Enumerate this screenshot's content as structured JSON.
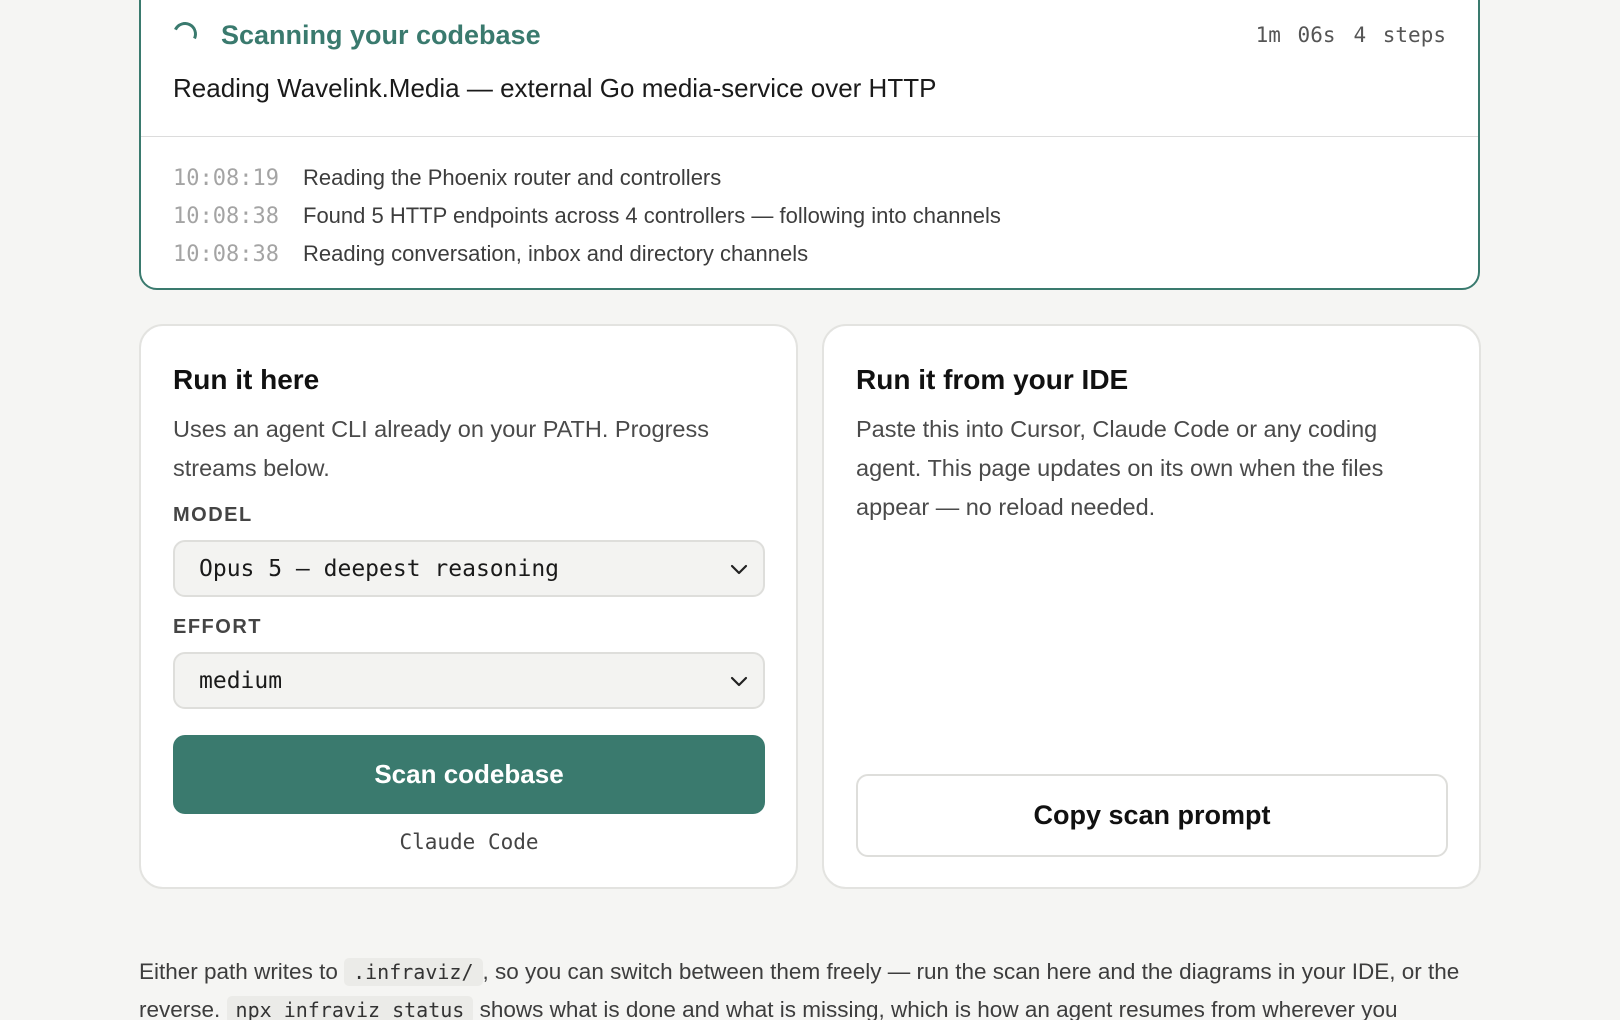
{
  "scan_status": {
    "title": "Scanning your codebase",
    "elapsed": "1m 06s",
    "steps": "4 steps",
    "current_action": "Reading Wavelink.Media — external Go media-service over HTTP",
    "log": [
      {
        "time": "10:08:19",
        "message": "Reading the Phoenix router and controllers"
      },
      {
        "time": "10:08:38",
        "message": "Found 5 HTTP endpoints across 4 controllers — following into channels"
      },
      {
        "time": "10:08:38",
        "message": "Reading conversation, inbox and directory channels"
      }
    ]
  },
  "run_here": {
    "title": "Run it here",
    "description": "Uses an agent CLI already on your PATH. Progress streams below.",
    "model_label": "MODEL",
    "model_value": "Opus 5 — deepest reasoning",
    "effort_label": "EFFORT",
    "effort_value": "medium",
    "scan_button": "Scan codebase",
    "agent": "Claude Code"
  },
  "run_ide": {
    "title": "Run it from your IDE",
    "description": "Paste this into Cursor, Claude Code or any coding agent. This page updates on its own when the files appear — no reload needed.",
    "copy_button": "Copy scan prompt"
  },
  "footer": {
    "part1": "Either path writes to ",
    "code1": ".infraviz/",
    "part2": ", so you can switch between them freely — run the scan here and the diagrams in your IDE, or the reverse. ",
    "code2": "npx infraviz status",
    "part3": " shows what is done and what is missing, which is how an agent resumes from wherever you"
  },
  "colors": {
    "accent": "#3a7a6e",
    "background": "#f5f5f3",
    "card": "#ffffff"
  },
  "icons": {
    "spinner": "spinner-icon",
    "select_chevron": "chevron-down-icon"
  }
}
